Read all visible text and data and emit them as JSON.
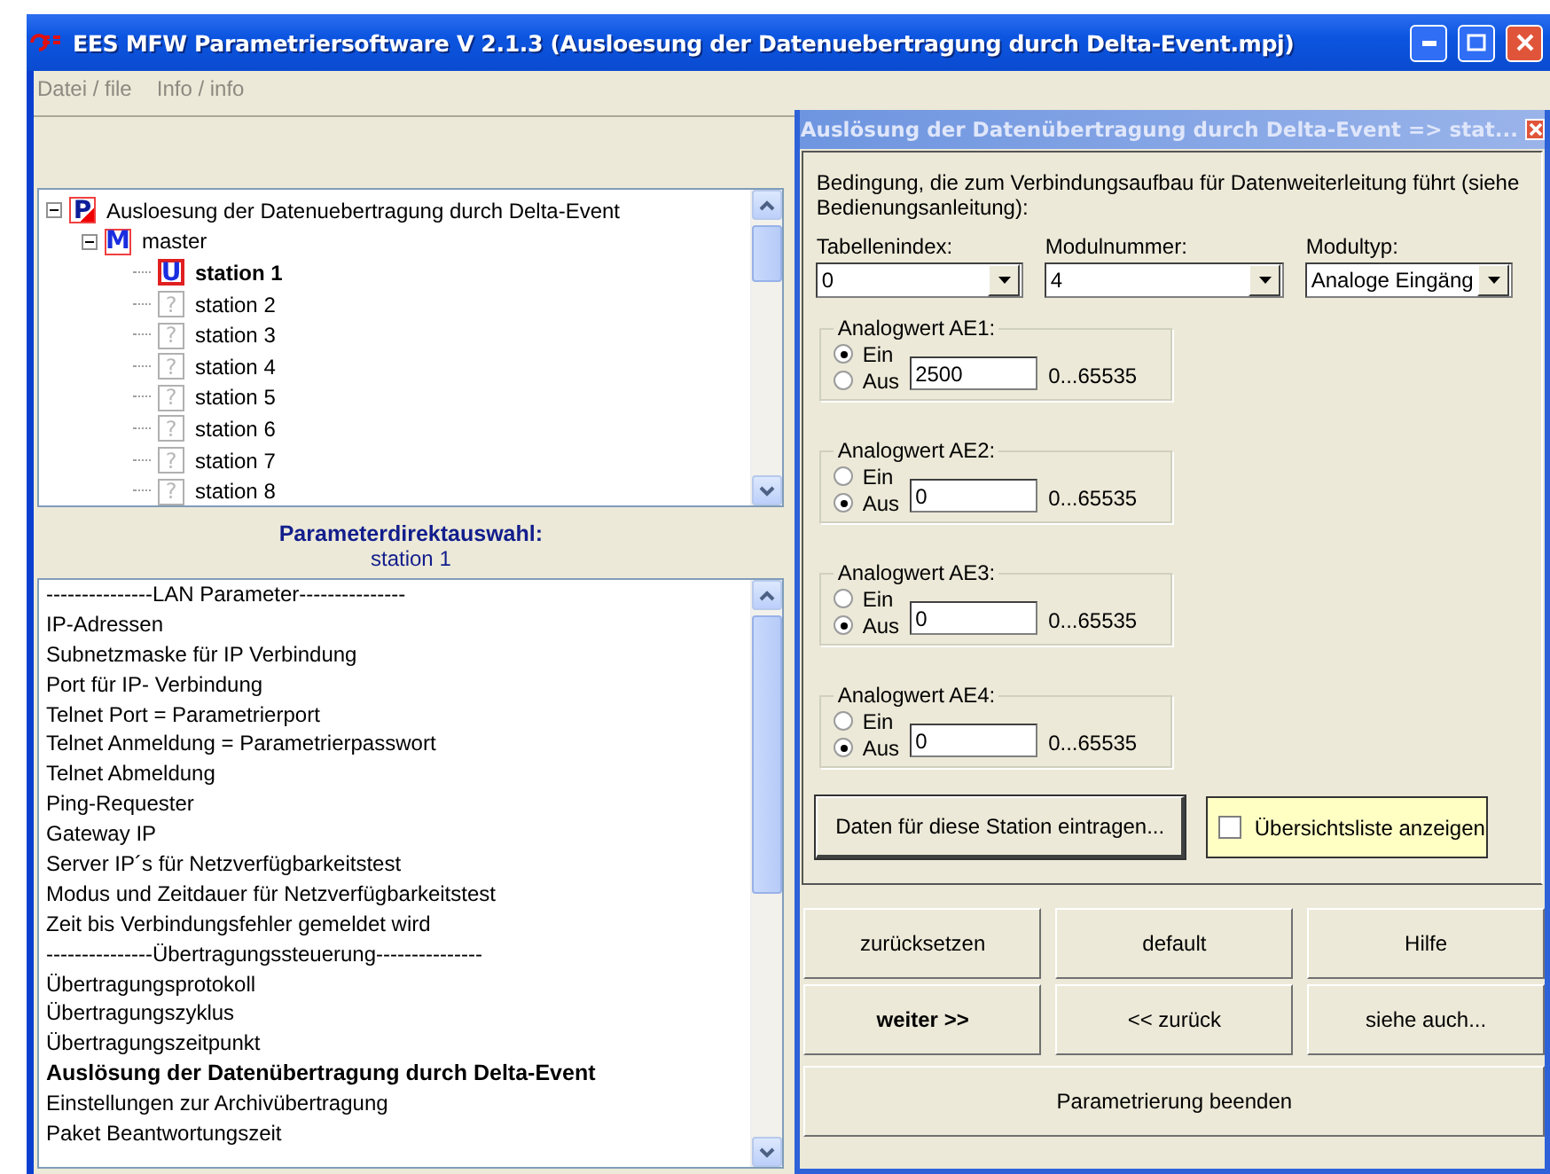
{
  "window": {
    "title": "EES MFW Parametriersoftware V 2.1.3 (Ausloesung der Datenuebertragung durch Delta-Event.mpj)"
  },
  "menu": [
    "Datei / file",
    "Info / info"
  ],
  "tree": [
    {
      "label": "Ausloesung der Datenuebertragung durch Delta-Event",
      "kind": "project",
      "badge": "P",
      "expanded": true,
      "selected": false,
      "children": [
        {
          "label": "master",
          "kind": "master",
          "badge": "M",
          "expanded": true,
          "selected": false,
          "children": [
            {
              "label": "station 1",
              "kind": "station",
              "badge": "U",
              "selected": true
            },
            {
              "label": "station 2",
              "kind": "empty",
              "badge": "?",
              "selected": false
            },
            {
              "label": "station 3",
              "kind": "empty",
              "badge": "?",
              "selected": false
            },
            {
              "label": "station 4",
              "kind": "empty",
              "badge": "?",
              "selected": false
            },
            {
              "label": "station 5",
              "kind": "empty",
              "badge": "?",
              "selected": false
            },
            {
              "label": "station 6",
              "kind": "empty",
              "badge": "?",
              "selected": false
            },
            {
              "label": "station 7",
              "kind": "empty",
              "badge": "?",
              "selected": false
            },
            {
              "label": "station 8",
              "kind": "empty",
              "badge": "?",
              "selected": false
            }
          ]
        }
      ]
    }
  ],
  "direct_selection": {
    "heading": "Parameterdirektauswahl:",
    "station": "station 1"
  },
  "parameter_list": [
    {
      "label": "---------------LAN Parameter---------------",
      "selected": false
    },
    {
      "label": "IP-Adressen",
      "selected": false
    },
    {
      "label": "Subnetzmaske für IP Verbindung",
      "selected": false
    },
    {
      "label": "Port für IP- Verbindung",
      "selected": false
    },
    {
      "label": "Telnet Port = Parametrierport",
      "selected": false
    },
    {
      "label": "Telnet Anmeldung = Parametrierpasswort",
      "selected": false
    },
    {
      "label": "Telnet Abmeldung",
      "selected": false
    },
    {
      "label": "Ping-Requester",
      "selected": false
    },
    {
      "label": "Gateway IP",
      "selected": false
    },
    {
      "label": "Server IP´s für Netzverfügbarkeitstest",
      "selected": false
    },
    {
      "label": "Modus und Zeitdauer für Netzverfügbarkeitstest",
      "selected": false
    },
    {
      "label": "Zeit bis Verbindungsfehler gemeldet wird",
      "selected": false
    },
    {
      "label": "---------------Übertragungssteuerung---------------",
      "selected": false
    },
    {
      "label": "Übertragungsprotokoll",
      "selected": false
    },
    {
      "label": "Übertragungszyklus",
      "selected": false
    },
    {
      "label": "Übertragungszeitpunkt",
      "selected": false
    },
    {
      "label": "Auslösung der Datenübertragung durch Delta-Event",
      "selected": true
    },
    {
      "label": "Einstellungen zur Archivübertragung",
      "selected": false
    },
    {
      "label": "Paket Beantwortungszeit",
      "selected": false
    }
  ],
  "dialog": {
    "title": "Auslösung der Datenübertragung durch Delta-Event  => stat...",
    "description": "Bedingung, die zum Verbindungsaufbau für Datenweiterleitung führt (siehe Bedienungsanleitung):",
    "dropdowns": [
      {
        "label": "Tabellenindex:",
        "value": "0"
      },
      {
        "label": "Modulnummer:",
        "value": "4"
      },
      {
        "label": "Modultyp:",
        "value": "Analoge Eingäng"
      }
    ],
    "analog_groups": [
      {
        "title": "Analogwert AE1:",
        "options": [
          {
            "label": "Ein",
            "selected": true
          },
          {
            "label": "Aus",
            "selected": false
          }
        ],
        "value": "2500",
        "range": "0...65535"
      },
      {
        "title": "Analogwert AE2:",
        "options": [
          {
            "label": "Ein",
            "selected": false
          },
          {
            "label": "Aus",
            "selected": true
          }
        ],
        "value": "0",
        "range": "0...65535"
      },
      {
        "title": "Analogwert AE3:",
        "options": [
          {
            "label": "Ein",
            "selected": false
          },
          {
            "label": "Aus",
            "selected": true
          }
        ],
        "value": "0",
        "range": "0...65535"
      },
      {
        "title": "Analogwert AE4:",
        "options": [
          {
            "label": "Ein",
            "selected": false
          },
          {
            "label": "Aus",
            "selected": true
          }
        ],
        "value": "0",
        "range": "0...65535"
      }
    ],
    "save_button": "Daten für diese Station eintragen...",
    "overview_checkbox": {
      "label": "Übersichtsliste anzeigen",
      "checked": false
    }
  },
  "buttons": [
    {
      "label": "zurücksetzen",
      "default": false
    },
    {
      "label": "default",
      "default": false
    },
    {
      "label": "Hilfe",
      "default": false
    },
    {
      "label": "weiter >>",
      "default": true
    },
    {
      "label": "<< zurück",
      "default": false
    },
    {
      "label": "siehe auch...",
      "default": false
    }
  ],
  "finish_button": "Parametrierung beenden"
}
